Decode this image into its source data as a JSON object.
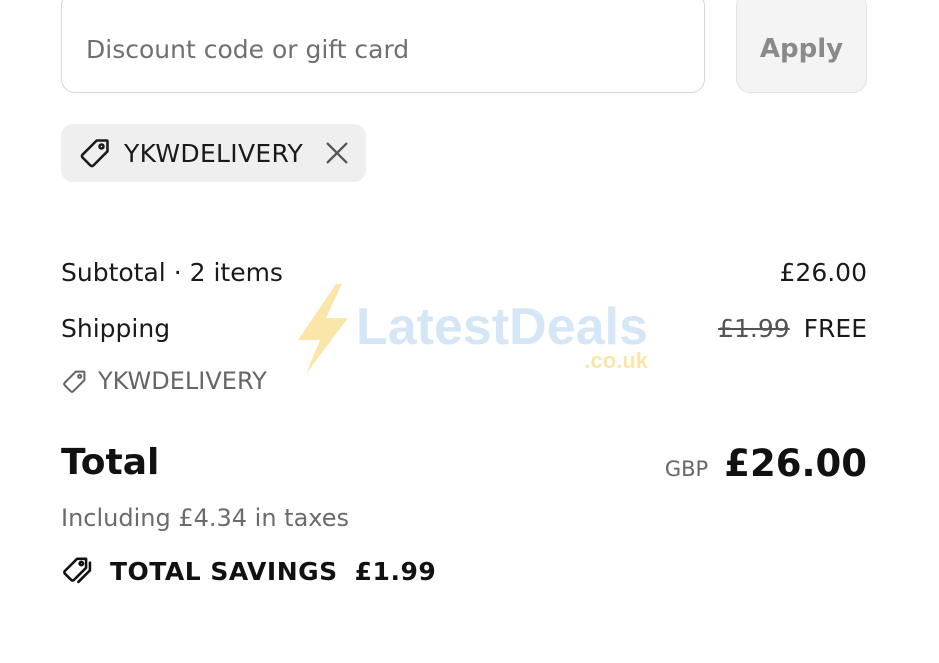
{
  "discount": {
    "placeholder": "Discount code or gift card",
    "apply_label": "Apply"
  },
  "applied_code": {
    "code": "YKWDELIVERY"
  },
  "summary": {
    "subtotal_label": "Subtotal · 2 items",
    "subtotal_value": "£26.00",
    "shipping_label": "Shipping",
    "shipping_original": "£1.99",
    "shipping_value": "FREE",
    "shipping_code": "YKWDELIVERY"
  },
  "total": {
    "label": "Total",
    "currency": "GBP",
    "amount": "£26.00",
    "taxes_note": "Including £4.34 in taxes"
  },
  "savings": {
    "label": "TOTAL SAVINGS",
    "amount": "£1.99"
  },
  "watermark": {
    "brand": "LatestDeals",
    "domain": ".co.uk"
  },
  "icons": {
    "tag": "tag-icon",
    "close": "close-icon",
    "savings": "savings-tags-icon",
    "lightning": "lightning-bolt-icon"
  },
  "colors": {
    "text": "#1a1a1a",
    "muted": "#6b6b6b",
    "chip_bg": "#efefef",
    "button_bg": "#f4f4f4",
    "input_border": "#d6d6d6",
    "watermark_blue": "#b3d4f0",
    "watermark_yellow": "#f8d264"
  }
}
